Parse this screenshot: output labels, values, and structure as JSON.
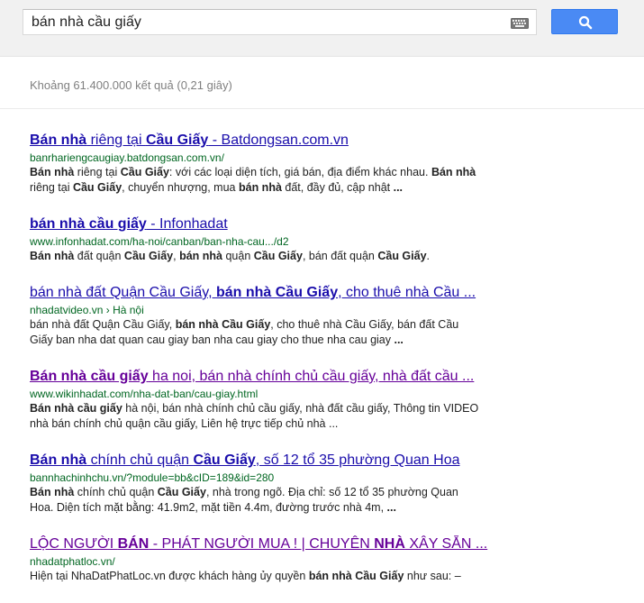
{
  "search": {
    "query": "bán nhà cầu giấy",
    "keyboard_icon": "keyboard-icon",
    "search_icon": "search-icon"
  },
  "stats": "Khoảng 61.400.000 kết quả (0,21 giây)",
  "colors": {
    "link": "#1a0dab",
    "visited": "#660099",
    "url": "#006621",
    "button": "#4a8af4"
  },
  "results": [
    {
      "visited": false,
      "title": [
        {
          "t": "Bán nhà",
          "b": true
        },
        {
          "t": " riêng tại ",
          "b": false
        },
        {
          "t": "Cầu Giấy",
          "b": true
        },
        {
          "t": " - Batdongsan.com.vn",
          "b": false
        }
      ],
      "url": "banrhariengcaugiay.batdongsan.com.vn/",
      "snippet": [
        {
          "t": "Bán nhà",
          "b": true
        },
        {
          "t": " riêng tại ",
          "b": false
        },
        {
          "t": "Cầu Giấy",
          "b": true
        },
        {
          "t": ": với các loại diện tích, giá bán, địa điểm khác nhau. ",
          "b": false
        },
        {
          "t": "Bán nhà",
          "b": true
        },
        {
          "t": " riêng tại ",
          "b": false
        },
        {
          "t": "Cầu Giấy",
          "b": true
        },
        {
          "t": ", chuyển nhượng, mua ",
          "b": false
        },
        {
          "t": "bán nhà",
          "b": true
        },
        {
          "t": " đất, đầy đủ, cập nhật ",
          "b": false
        },
        {
          "t": "...",
          "b": true
        }
      ]
    },
    {
      "visited": false,
      "title": [
        {
          "t": "bán nhà cầu giấy",
          "b": true
        },
        {
          "t": " - Infonhadat",
          "b": false
        }
      ],
      "url": "www.infonhadat.com/ha-noi/canban/ban-nha-cau.../d2",
      "snippet": [
        {
          "t": "Bán nhà",
          "b": true
        },
        {
          "t": " đất quận ",
          "b": false
        },
        {
          "t": "Cầu Giấy",
          "b": true
        },
        {
          "t": ", ",
          "b": false
        },
        {
          "t": "bán nhà",
          "b": true
        },
        {
          "t": " quận ",
          "b": false
        },
        {
          "t": "Cầu Giấy",
          "b": true
        },
        {
          "t": ", bán đất quận ",
          "b": false
        },
        {
          "t": "Cầu Giấy",
          "b": true
        },
        {
          "t": ".",
          "b": false
        }
      ]
    },
    {
      "visited": false,
      "title": [
        {
          "t": "bán nhà đất Quận Cầu Giấy, ",
          "b": false
        },
        {
          "t": "bán nhà Cầu Giấy",
          "b": true
        },
        {
          "t": ", cho thuê nhà Cầu ...",
          "b": false
        }
      ],
      "url": "nhadatvideo.vn › Hà nội",
      "snippet": [
        {
          "t": "bán nhà đất Quận Cầu Giấy, ",
          "b": false
        },
        {
          "t": "bán nhà Cầu Giấy",
          "b": true
        },
        {
          "t": ", cho thuê nhà Cầu Giấy, bán đất Cầu Giấy ban nha dat quan cau giay ban nha cau giay cho thue nha cau giay ",
          "b": false
        },
        {
          "t": "...",
          "b": true
        }
      ]
    },
    {
      "visited": true,
      "title": [
        {
          "t": "Bán nhà cầu giấy",
          "b": true
        },
        {
          "t": " ha noi, bán nhà chính chủ cầu giấy, nhà đất cầu ...",
          "b": false
        }
      ],
      "url": "www.wikinhadat.com/nha-dat-ban/cau-giay.html",
      "snippet": [
        {
          "t": "Bán nhà cầu giấy",
          "b": true
        },
        {
          "t": " hà nội, bán nhà chính chủ cầu giấy, nhà đất cầu giấy, Thông tin VIDEO nhà bán chính chủ quận cầu giấy, Liên hệ trực tiếp chủ nhà ...",
          "b": false
        }
      ]
    },
    {
      "visited": false,
      "title": [
        {
          "t": "Bán nhà",
          "b": true
        },
        {
          "t": " chính chủ quận ",
          "b": false
        },
        {
          "t": "Cầu Giấy",
          "b": true
        },
        {
          "t": ", số 12 tổ 35 phường Quan Hoa",
          "b": false
        }
      ],
      "url": "bannhachinhchu.vn/?module=bb&cID=189&id=280",
      "snippet": [
        {
          "t": "Bán nhà",
          "b": true
        },
        {
          "t": " chính chủ quận ",
          "b": false
        },
        {
          "t": "Cầu Giấy",
          "b": true
        },
        {
          "t": ", nhà trong ngõ. Địa chỉ: số 12 tổ 35 phường Quan Hoa. Diện tích mặt bằng: 41.9m2, mặt tiền 4.4m, đường trước nhà 4m, ",
          "b": false
        },
        {
          "t": "...",
          "b": true
        }
      ]
    },
    {
      "visited": true,
      "title": [
        {
          "t": "LỘC NGƯỜI ",
          "b": false
        },
        {
          "t": "BÁN",
          "b": true
        },
        {
          "t": " - PHÁT NGƯỜI MUA ! | CHUYÊN ",
          "b": false
        },
        {
          "t": "NHÀ",
          "b": true
        },
        {
          "t": " XÂY SẴN ...",
          "b": false
        }
      ],
      "url": "nhadatphatloc.vn/",
      "snippet": [
        {
          "t": "Hiện tại NhaDatPhatLoc.vn được khách hàng ủy quyền ",
          "b": false
        },
        {
          "t": "bán nhà Cầu Giấy",
          "b": true
        },
        {
          "t": " như sau: –",
          "b": false
        }
      ]
    }
  ]
}
